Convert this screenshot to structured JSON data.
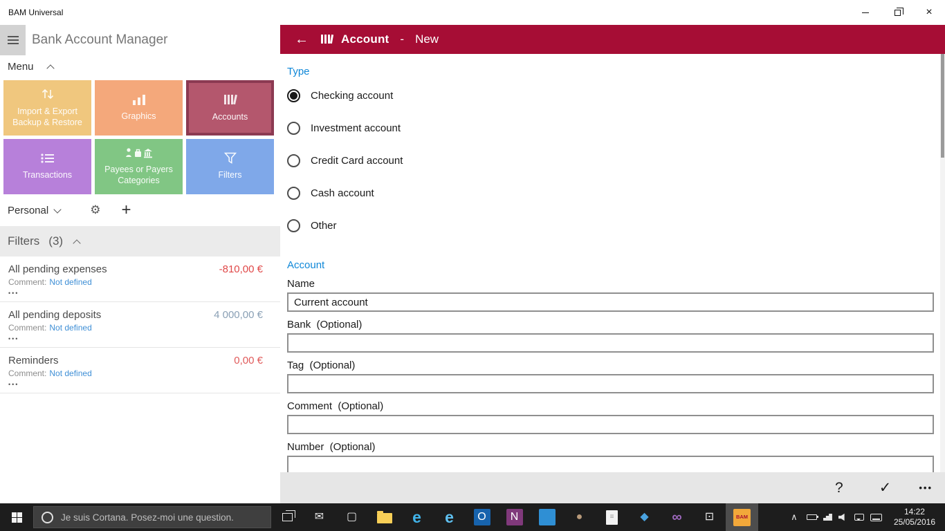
{
  "colors": {
    "accent_blue": "#1088d8",
    "link_blue": "#3f8fd6",
    "header_red": "#a60d35",
    "negative_red": "#e04848",
    "neutral_amount_gray": "#8aa0b5"
  },
  "titlebar": {
    "title": "BAM Universal",
    "close_glyph": "×"
  },
  "left_panel": {
    "app_title": "Bank Account Manager",
    "menu_label": "Menu",
    "tiles": [
      {
        "id": "import-export",
        "lines": [
          "Import & Export",
          "Backup & Restore"
        ],
        "color": "#f0c77e"
      },
      {
        "id": "graphics",
        "lines": [
          "Graphics"
        ],
        "color": "#f4a87b"
      },
      {
        "id": "accounts",
        "lines": [
          "Accounts"
        ],
        "color": "#b4576d",
        "selected": true
      },
      {
        "id": "transactions",
        "lines": [
          "Transactions"
        ],
        "color": "#b780da"
      },
      {
        "id": "payees",
        "lines": [
          "Payees or Payers",
          "Categories"
        ],
        "color": "#81c684"
      },
      {
        "id": "filters",
        "lines": [
          "Filters"
        ],
        "color": "#7fa8e9"
      }
    ],
    "profile_label": "Personal",
    "gear_glyph": "⚙",
    "plus_glyph": "+",
    "filters_header": "Filters",
    "filters_count": "(3)",
    "filter_items": [
      {
        "name": "All pending expenses",
        "amount": "-810,00 €",
        "amount_color": "#e04848",
        "comment_label": "Comment:",
        "comment_value": "Not defined",
        "dots": "•••"
      },
      {
        "name": "All pending deposits",
        "amount": "4 000,00 €",
        "amount_color": "#8aa0b5",
        "comment_label": "Comment:",
        "comment_value": "Not defined",
        "dots": "•••"
      },
      {
        "name": "Reminders",
        "amount": "0,00 €",
        "amount_color": "#e05a5a",
        "comment_label": "Comment:",
        "comment_value": "Not defined",
        "dots": "•••"
      }
    ]
  },
  "detail": {
    "header": {
      "back": "←",
      "title": "Account",
      "separator": "-",
      "subtitle": "New",
      "color": "#a60d35"
    },
    "type_label": "Type",
    "account_label": "Account",
    "radio_options": [
      {
        "label": "Checking account",
        "selected": true
      },
      {
        "label": "Investment account",
        "selected": false
      },
      {
        "label": "Credit Card account",
        "selected": false
      },
      {
        "label": "Cash account",
        "selected": false
      },
      {
        "label": "Other",
        "selected": false
      }
    ],
    "fields": [
      {
        "label": "Name",
        "value": "Current account"
      },
      {
        "label": "Bank  (Optional)",
        "value": ""
      },
      {
        "label": "Tag  (Optional)",
        "value": ""
      },
      {
        "label": "Comment  (Optional)",
        "value": ""
      },
      {
        "label": "Number  (Optional)",
        "value": ""
      }
    ],
    "commandbar": {
      "help": "?",
      "accept": "✓",
      "more": "•••"
    }
  },
  "taskbar": {
    "search_text": "Je suis Cortana. Posez-moi une question.",
    "time": "14:22",
    "date": "25/05/2016",
    "apps": [
      {
        "name": "mail",
        "glyph": "✉",
        "color": "#e8e8e8",
        "bg": ""
      },
      {
        "name": "store",
        "glyph": "▢",
        "color": "#e8e8e8",
        "bg": ""
      },
      {
        "name": "file-explorer",
        "glyph": "",
        "color": "",
        "bg": ""
      },
      {
        "name": "edge",
        "glyph": "e",
        "color": "#41b4ea",
        "bg": ""
      },
      {
        "name": "internet-explorer",
        "glyph": "e",
        "color": "#5fc0f0",
        "bg": ""
      },
      {
        "name": "outlook",
        "glyph": "O",
        "color": "#ffffff",
        "bg": "#1763ad"
      },
      {
        "name": "onenote",
        "glyph": "N",
        "color": "#ffffff",
        "bg": "#80397b"
      },
      {
        "name": "app-blue",
        "glyph": "",
        "color": "",
        "bg": "#2f8fd4"
      },
      {
        "name": "app-dark",
        "glyph": "●",
        "color": "#b89a7a",
        "bg": ""
      },
      {
        "name": "document-app",
        "glyph": "≡",
        "color": "#9a9a9a",
        "bg": ""
      },
      {
        "name": "app-diamond",
        "glyph": "◆",
        "color": "#4aa3e0",
        "bg": ""
      },
      {
        "name": "visual-studio",
        "glyph": "∞",
        "color": "#a06ac0",
        "bg": ""
      },
      {
        "name": "photos",
        "glyph": "⊡",
        "color": "#e8e8e8",
        "bg": ""
      },
      {
        "name": "bam",
        "glyph": "BAM",
        "color": "#a81030",
        "bg": "#f2a83a"
      }
    ]
  }
}
